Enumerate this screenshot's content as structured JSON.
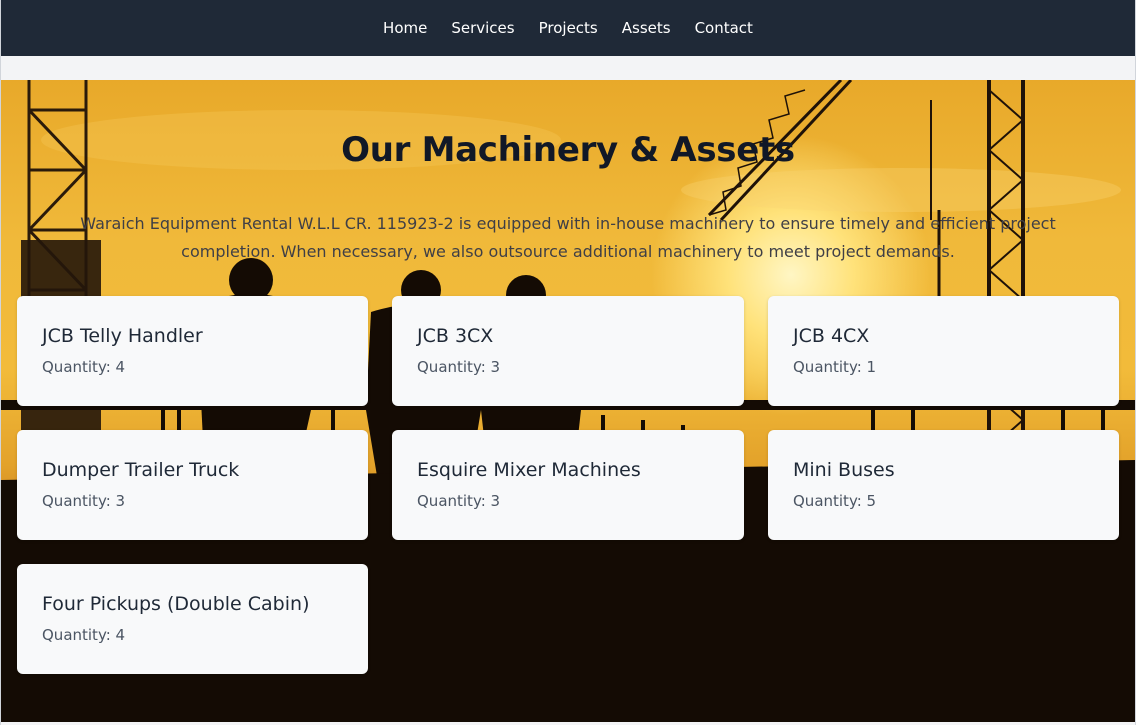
{
  "nav": {
    "items": [
      {
        "label": "Home"
      },
      {
        "label": "Services"
      },
      {
        "label": "Projects"
      },
      {
        "label": "Assets"
      },
      {
        "label": "Contact"
      }
    ]
  },
  "hero": {
    "title": "Our Machinery & Assets",
    "description": "Waraich Equipment Rental W.L.L CR. 115923-2 is equipped with in-house machinery to ensure timely and efficient project completion. When necessary, we also outsource additional machinery to meet project demands."
  },
  "assets": [
    {
      "name": "JCB Telly Handler",
      "quantity": "Quantity: 4"
    },
    {
      "name": "JCB 3CX",
      "quantity": "Quantity: 3"
    },
    {
      "name": "JCB 4CX",
      "quantity": "Quantity: 1"
    },
    {
      "name": "Dumper Trailer Truck",
      "quantity": "Quantity: 3"
    },
    {
      "name": "Esquire Mixer Machines",
      "quantity": "Quantity: 3"
    },
    {
      "name": "Mini Buses",
      "quantity": "Quantity: 5"
    },
    {
      "name": "Four Pickups (Double Cabin)",
      "quantity": "Quantity: 4"
    }
  ],
  "colors": {
    "nav_bg": "#1f2937",
    "card_bg": "#f8f9fa",
    "title_color": "#111827"
  }
}
